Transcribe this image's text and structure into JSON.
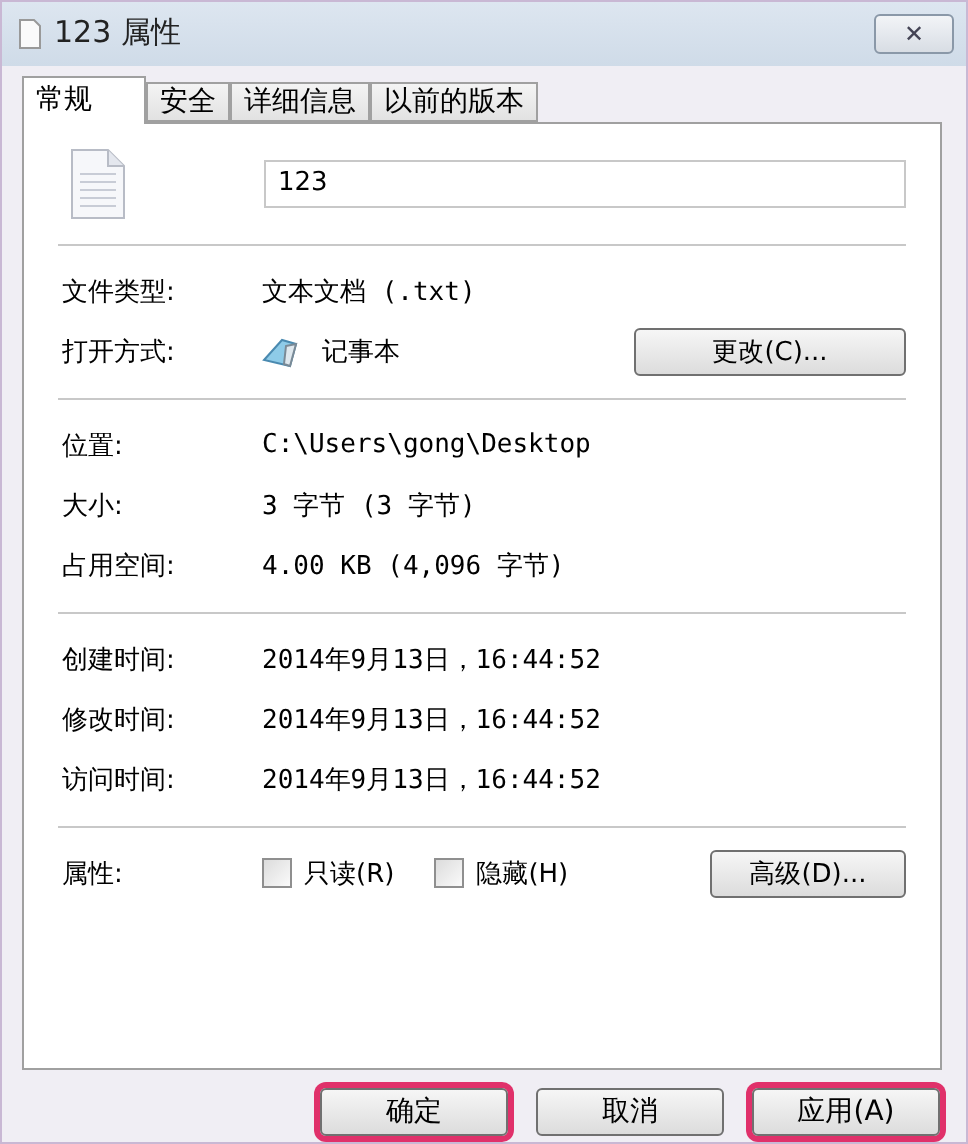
{
  "window": {
    "title": "123 属性",
    "close": "✕"
  },
  "tabs": [
    {
      "label": "常规",
      "selected": true
    },
    {
      "label": "安全",
      "selected": false
    },
    {
      "label": "详细信息",
      "selected": false
    },
    {
      "label": "以前的版本",
      "selected": false
    }
  ],
  "name_field": {
    "value": "123"
  },
  "sections": [
    [
      {
        "label": "文件类型:",
        "value": "文本文档 (.txt)"
      },
      {
        "label": "打开方式:",
        "value": "记事本",
        "kind": "app",
        "button": "更改(C)..."
      }
    ],
    [
      {
        "label": "位置:",
        "value": "C:\\Users\\gong\\Desktop"
      },
      {
        "label": "大小:",
        "value": "3 字节 (3 字节)"
      },
      {
        "label": "占用空间:",
        "value": "4.00 KB (4,096 字节)"
      }
    ],
    [
      {
        "label": "创建时间:",
        "value": "2014年9月13日，16:44:52"
      },
      {
        "label": "修改时间:",
        "value": "2014年9月13日，16:44:52"
      },
      {
        "label": "访问时间:",
        "value": "2014年9月13日，16:44:52"
      }
    ]
  ],
  "attributes": {
    "label": "属性:",
    "checkboxes": [
      {
        "label": "只读(R)",
        "checked": false
      },
      {
        "label": "隐藏(H)",
        "checked": false
      }
    ],
    "button": "高级(D)..."
  },
  "buttons": [
    {
      "label": "确定",
      "highlighted": true
    },
    {
      "label": "取消",
      "highlighted": false
    },
    {
      "label": "应用(A)",
      "highlighted": true
    }
  ]
}
